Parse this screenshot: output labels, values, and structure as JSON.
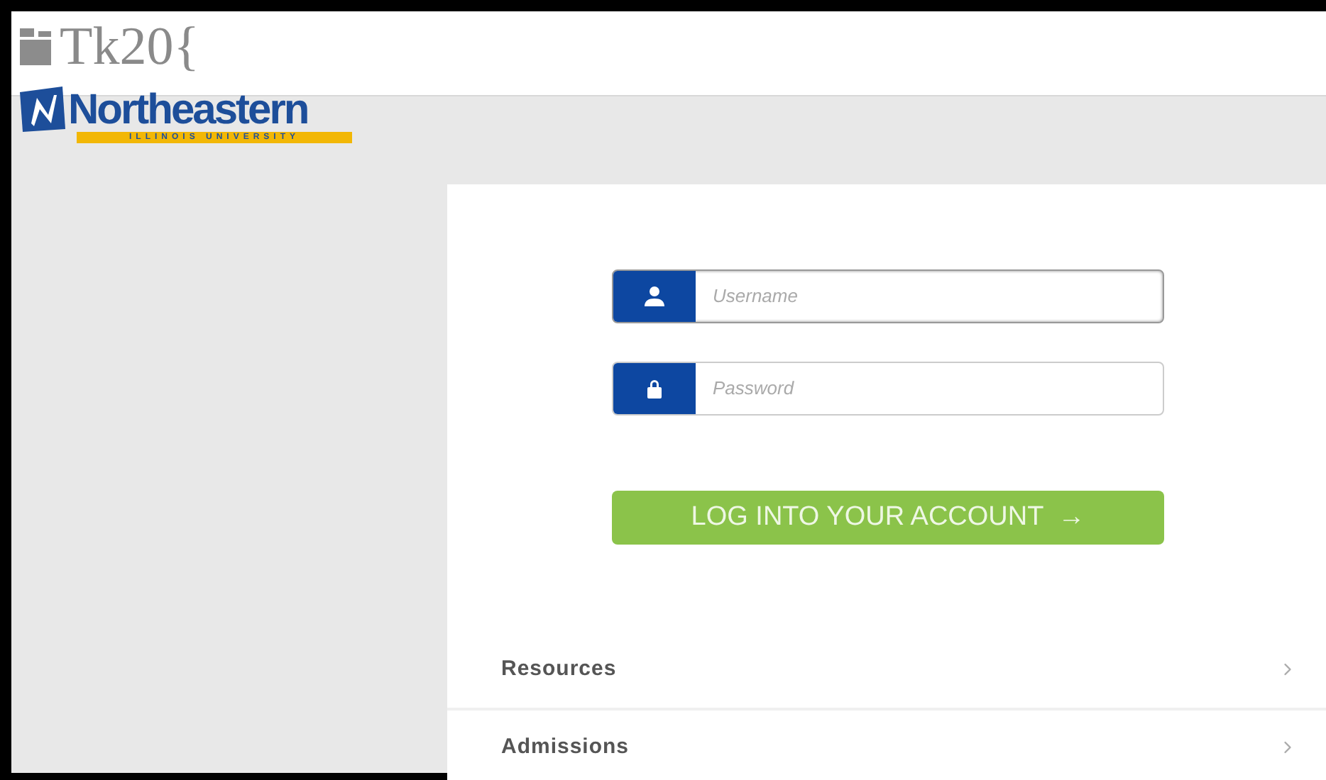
{
  "header": {
    "product_logo": "Tk20{",
    "university_name": "Northeastern",
    "university_subtitle": "ILLINOIS UNIVERSITY"
  },
  "login": {
    "username": {
      "placeholder": "Username"
    },
    "password": {
      "placeholder": "Password"
    },
    "submit": {
      "label": "LOG INTO YOUR ACCOUNT",
      "arrow": "→"
    }
  },
  "links": [
    {
      "label": "Resources"
    },
    {
      "label": "Admissions"
    }
  ]
}
